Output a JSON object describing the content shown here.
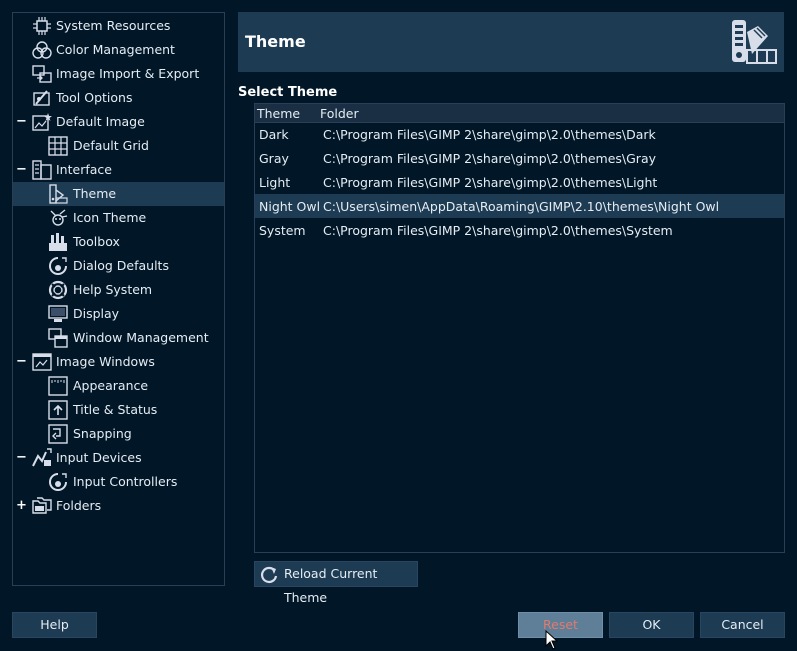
{
  "tree": {
    "items": [
      {
        "label": "System Resources",
        "icon": "chip-icon",
        "expander": "",
        "depth": 0
      },
      {
        "label": "Color Management",
        "icon": "color-circles-icon",
        "expander": "",
        "depth": 0
      },
      {
        "label": "Image Import & Export",
        "icon": "import-export-icon",
        "expander": "",
        "depth": 0
      },
      {
        "label": "Tool Options",
        "icon": "tool-options-icon",
        "expander": "",
        "depth": 0
      },
      {
        "label": "Default Image",
        "icon": "default-image-icon",
        "expander": "−",
        "depth": 0
      },
      {
        "label": "Default Grid",
        "icon": "grid-icon",
        "expander": "",
        "depth": 1
      },
      {
        "label": "Interface",
        "icon": "interface-icon",
        "expander": "−",
        "depth": 0
      },
      {
        "label": "Theme",
        "icon": "theme-icon",
        "expander": "",
        "depth": 1
      },
      {
        "label": "Icon Theme",
        "icon": "icon-theme-icon",
        "expander": "",
        "depth": 1
      },
      {
        "label": "Toolbox",
        "icon": "toolbox-icon",
        "expander": "",
        "depth": 1
      },
      {
        "label": "Dialog Defaults",
        "icon": "dialog-defaults-icon",
        "expander": "",
        "depth": 1
      },
      {
        "label": "Help System",
        "icon": "lifebuoy-icon",
        "expander": "",
        "depth": 1
      },
      {
        "label": "Display",
        "icon": "display-icon",
        "expander": "",
        "depth": 1
      },
      {
        "label": "Window Management",
        "icon": "windows-icon",
        "expander": "",
        "depth": 1
      },
      {
        "label": "Image Windows",
        "icon": "image-window-icon",
        "expander": "−",
        "depth": 0
      },
      {
        "label": "Appearance",
        "icon": "appearance-icon",
        "expander": "",
        "depth": 1
      },
      {
        "label": "Title & Status",
        "icon": "title-status-icon",
        "expander": "",
        "depth": 1
      },
      {
        "label": "Snapping",
        "icon": "snapping-icon",
        "expander": "",
        "depth": 1
      },
      {
        "label": "Input Devices",
        "icon": "input-devices-icon",
        "expander": "−",
        "depth": 0
      },
      {
        "label": "Input Controllers",
        "icon": "input-controllers-icon",
        "expander": "",
        "depth": 1
      },
      {
        "label": "Folders",
        "icon": "folders-icon",
        "expander": "+",
        "depth": 0
      }
    ],
    "selected_index": 7
  },
  "header": {
    "title": "Theme",
    "icon": "theme-large-icon"
  },
  "section_title": "Select Theme",
  "theme_list": {
    "columns": [
      "Theme",
      "Folder"
    ],
    "rows": [
      {
        "theme": "Dark",
        "folder": "C:\\Program Files\\GIMP 2\\share\\gimp\\2.0\\themes\\Dark"
      },
      {
        "theme": "Gray",
        "folder": "C:\\Program Files\\GIMP 2\\share\\gimp\\2.0\\themes\\Gray"
      },
      {
        "theme": "Light",
        "folder": "C:\\Program Files\\GIMP 2\\share\\gimp\\2.0\\themes\\Light"
      },
      {
        "theme": "Night Owl",
        "folder": "C:\\Users\\simen\\AppData\\Roaming\\GIMP\\2.10\\themes\\Night Owl"
      },
      {
        "theme": "System",
        "folder": "C:\\Program Files\\GIMP 2\\share\\gimp\\2.0\\themes\\System"
      }
    ],
    "selected_index": 3
  },
  "reload_button": {
    "label": "Reload Current Theme",
    "icon": "reload-icon"
  },
  "buttons": {
    "help": "Help",
    "reset": "Reset",
    "ok": "OK",
    "cancel": "Cancel"
  },
  "colors": {
    "background": "#011627",
    "panel": "#1d3b53",
    "selection": "#1d3b53",
    "reset_button": "#5f7e97",
    "reset_text": "#e07b6f"
  }
}
